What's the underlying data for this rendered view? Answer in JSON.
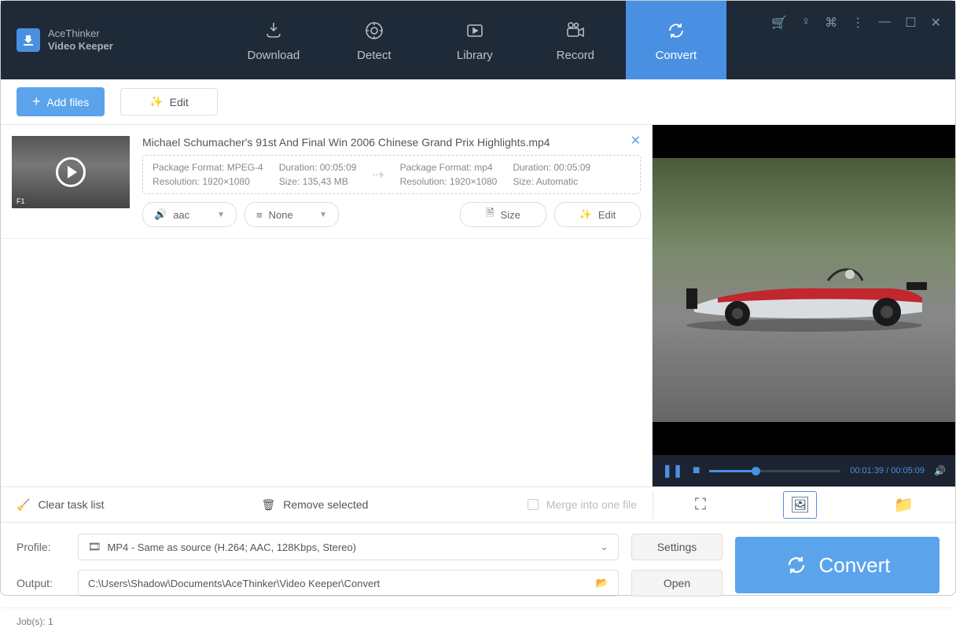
{
  "app": {
    "name_line1": "AceThinker",
    "name_line2": "Video Keeper"
  },
  "tabs": {
    "download": "Download",
    "detect": "Detect",
    "library": "Library",
    "record": "Record",
    "convert": "Convert"
  },
  "toolbar": {
    "add_files": "Add files",
    "edit": "Edit"
  },
  "file": {
    "title": "Michael Schumacher's 91st And Final Win  2006 Chinese Grand Prix Highlights.mp4",
    "src_package": "Package Format: MPEG-4",
    "src_resolution": "Resolution: 1920×1080",
    "src_duration": "Duration: 00:05:09",
    "src_size": "Size: 135,43 MB",
    "dst_package": "Package Format: mp4",
    "dst_resolution": "Resolution: 1920×1080",
    "dst_duration": "Duration: 00:05:09",
    "dst_size": "Size: Automatic",
    "audio_dd": "aac",
    "subtitle_dd": "None",
    "size_btn": "Size",
    "edit_btn": "Edit"
  },
  "player": {
    "time": "00:01:39 / 00:05:09"
  },
  "sec": {
    "clear": "Clear task list",
    "remove": "Remove selected",
    "merge": "Merge into one file"
  },
  "config": {
    "profile_label": "Profile:",
    "profile_value": "MP4 - Same as source (H.264; AAC, 128Kbps, Stereo)",
    "output_label": "Output:",
    "output_value": "C:\\Users\\Shadow\\Documents\\AceThinker\\Video Keeper\\Convert",
    "settings_btn": "Settings",
    "open_btn": "Open",
    "convert_btn": "Convert"
  },
  "status": {
    "jobs": "Job(s): 1"
  }
}
